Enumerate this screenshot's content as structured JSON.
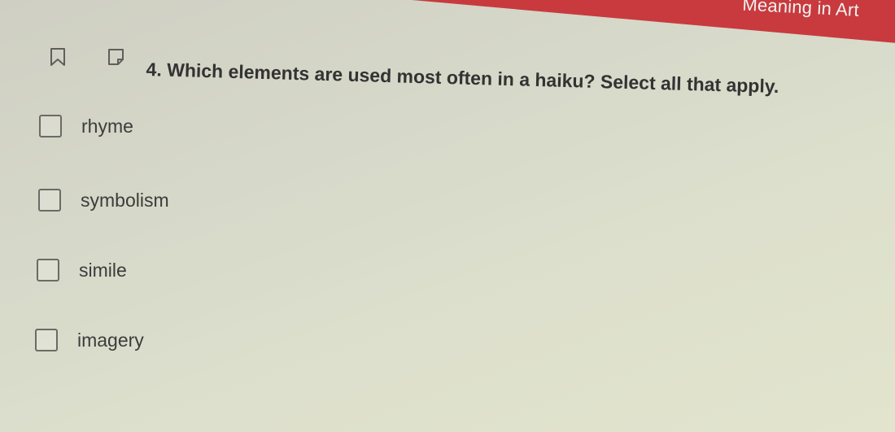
{
  "header": {
    "title": "Meaning in Art",
    "accent_color": "#c83a3e"
  },
  "toolbar": {
    "icons": [
      "bookmark-icon",
      "note-icon"
    ]
  },
  "question": {
    "text": "4. Which elements are used most often in a haiku? Select all that apply."
  },
  "options": [
    {
      "label": "rhyme",
      "checked": false
    },
    {
      "label": "symbolism",
      "checked": false
    },
    {
      "label": "simile",
      "checked": false
    },
    {
      "label": "imagery",
      "checked": false
    }
  ]
}
